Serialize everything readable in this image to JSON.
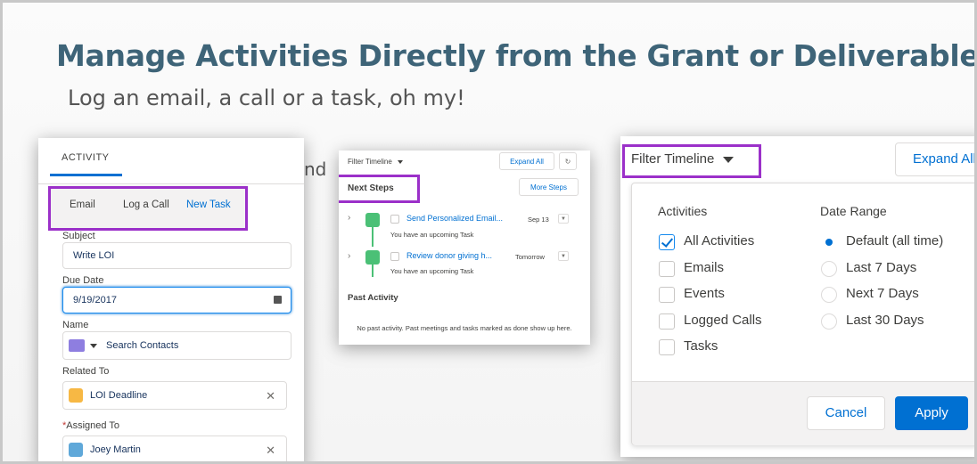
{
  "slide": {
    "title": "Manage Activities Directly from the Grant or Deliverable",
    "subtitle": "Log an email, a call or a task, oh my!",
    "background_text": "nd"
  },
  "colors": {
    "highlight": "#9b30c9",
    "accent": "#0070d2",
    "title": "#3e6478",
    "task_green": "#4bc076"
  },
  "activity_panel": {
    "header": "ACTIVITY",
    "tabs": [
      {
        "label": "Email"
      },
      {
        "label": "Log a Call"
      },
      {
        "label": "New Task",
        "active": true
      }
    ],
    "fields": {
      "subject": {
        "label": "Subject",
        "value": "Write LOI"
      },
      "due_date": {
        "label": "Due Date",
        "value": "9/19/2017",
        "icon": "calendar-icon"
      },
      "name": {
        "label": "Name",
        "placeholder": "Search Contacts",
        "icon": "contact-icon"
      },
      "related_to": {
        "label": "Related To",
        "value": "LOI Deadline",
        "icon": "crown-icon"
      },
      "assigned_to": {
        "required_mark": "*",
        "label": "Assigned To",
        "value": "Joey Martin",
        "icon": "user-icon"
      }
    }
  },
  "timeline_panel": {
    "filter_label": "Filter Timeline",
    "expand_all": "Expand All",
    "refresh_icon": "refresh-icon",
    "next_steps": "Next Steps",
    "more_steps": "More Steps",
    "tasks": [
      {
        "title": "Send Personalized Email...",
        "date": "Sep 13",
        "meta": "You have an upcoming Task"
      },
      {
        "title": "Review donor giving h...",
        "date": "Tomorrow",
        "meta": "You have an upcoming Task"
      }
    ],
    "past_activity": "Past Activity",
    "no_past": "No past activity. Past meetings and tasks marked as done show up here."
  },
  "filter_panel": {
    "filter_label": "Filter Timeline",
    "expand_all": "Expand All",
    "activities_heading": "Activities",
    "activities": [
      {
        "label": "All Activities",
        "checked": true
      },
      {
        "label": "Emails",
        "checked": false
      },
      {
        "label": "Events",
        "checked": false
      },
      {
        "label": "Logged Calls",
        "checked": false
      },
      {
        "label": "Tasks",
        "checked": false
      }
    ],
    "date_heading": "Date Range",
    "date_ranges": [
      {
        "label": "Default (all time)",
        "selected": true
      },
      {
        "label": "Last 7 Days",
        "selected": false
      },
      {
        "label": "Next 7 Days",
        "selected": false
      },
      {
        "label": "Last 30 Days",
        "selected": false
      }
    ],
    "cancel": "Cancel",
    "apply": "Apply"
  }
}
